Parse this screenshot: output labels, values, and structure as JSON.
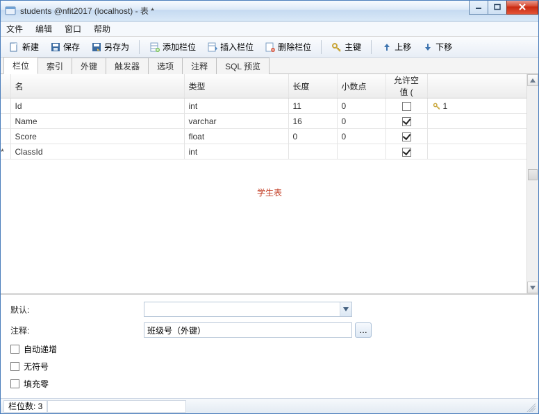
{
  "window": {
    "title": "students @nfit2017 (localhost) - 表 *"
  },
  "menu": {
    "file": "文件",
    "edit": "编辑",
    "window": "窗口",
    "help": "帮助"
  },
  "toolbar": {
    "new": "新建",
    "save": "保存",
    "saveas": "另存为",
    "addcol": "添加栏位",
    "insertcol": "插入栏位",
    "delcol": "删除栏位",
    "pk": "主键",
    "up": "上移",
    "down": "下移"
  },
  "tabs": {
    "columns": "栏位",
    "indexes": "索引",
    "fks": "外键",
    "triggers": "触发器",
    "options": "选项",
    "comment": "注释",
    "sqlpreview": "SQL 预览"
  },
  "grid": {
    "headers": {
      "name": "名",
      "type": "类型",
      "len": "长度",
      "dec": "小数点",
      "null": "允许空值 ("
    },
    "rows": [
      {
        "mark": "",
        "name": "Id",
        "type": "int",
        "len": "11",
        "dec": "0",
        "null": false,
        "pk": "1"
      },
      {
        "mark": "",
        "name": "Name",
        "type": "varchar",
        "len": "16",
        "dec": "0",
        "null": true,
        "pk": ""
      },
      {
        "mark": "",
        "name": "Score",
        "type": "float",
        "len": "0",
        "dec": "0",
        "null": true,
        "pk": ""
      },
      {
        "mark": "*",
        "name": "ClassId",
        "type": "int",
        "len": "",
        "dec": "",
        "null": true,
        "pk": ""
      }
    ],
    "caption": "学生表"
  },
  "props": {
    "default_label": "默认:",
    "default_value": "",
    "comment_label": "注释:",
    "comment_value": "班级号（外键）",
    "auto_inc": "自动递增",
    "unsigned": "无符号",
    "zerofill": "填充零"
  },
  "status": {
    "count_label": "栏位数: 3"
  }
}
